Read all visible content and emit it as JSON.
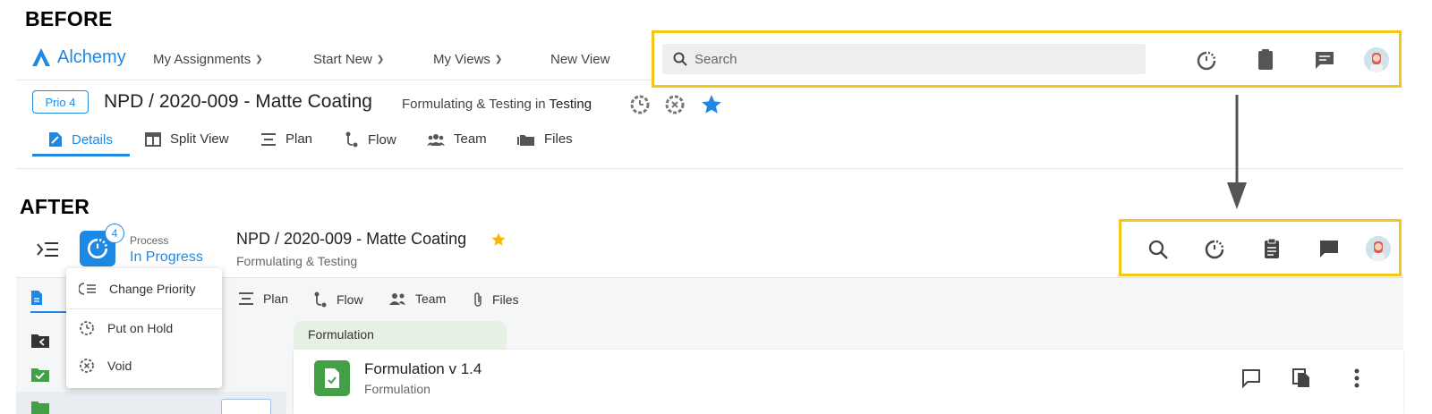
{
  "before": {
    "section_label": "BEFORE",
    "brand": "Alchemy",
    "nav": {
      "my_assignments": "My Assignments",
      "start_new": "Start New",
      "my_views": "My Views",
      "new_view": "New View"
    },
    "search": {
      "placeholder": "Search"
    },
    "priority": "Prio 4",
    "record_title": "NPD / 2020-009 - Matte Coating",
    "status_prefix": "Formulating & Testing in",
    "status_stage": "Testing",
    "tabs": [
      "Details",
      "Split View",
      "Plan",
      "Flow",
      "Team",
      "Files"
    ]
  },
  "after": {
    "section_label": "AFTER",
    "process_badge": "4",
    "process_label": "Process",
    "process_status": "In Progress",
    "record_title": "NPD / 2020-009 - Matte Coating",
    "record_subtitle": "Formulating & Testing",
    "menu": {
      "change_priority": "Change Priority",
      "put_on_hold": "Put on Hold",
      "void": "Void"
    },
    "tabs": [
      "Plan",
      "Flow",
      "Team",
      "Files"
    ],
    "section_tab": "Formulation",
    "card_title": "Formulation v 1.4",
    "card_subtitle": "Formulation"
  },
  "colors": {
    "accent": "#1e88e5",
    "highlight": "#f5c518",
    "star": "#1e88e5",
    "star_after": "#f9b800",
    "green": "#43a047"
  }
}
